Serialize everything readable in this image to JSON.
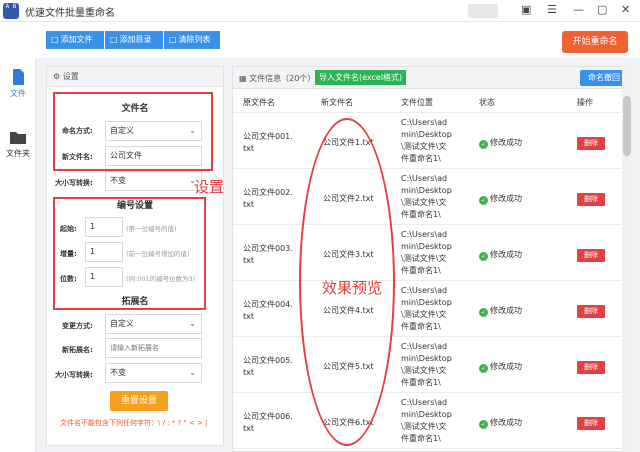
{
  "window": {
    "title": "优速文件批量重命名",
    "logo_text": "A B"
  },
  "toolbar": {
    "add_file": "添加文件",
    "add_dir": "添加目录",
    "clear_list": "清除列表",
    "start": "开始重命名"
  },
  "nav": {
    "file": "文件",
    "folder": "文件夹"
  },
  "settings": {
    "header": "设置",
    "filename_section": "文件名",
    "rename_mode_label": "命名方式:",
    "rename_mode_value": "自定义",
    "new_name_label": "新文件名:",
    "new_name_value": "公司文件",
    "case_label": "大小写转换:",
    "case_value": "不变",
    "numbering_section": "编号设置",
    "start_label": "起始:",
    "start_value": "1",
    "start_hint": "(第一位编号的值)",
    "increment_label": "增量:",
    "increment_value": "1",
    "increment_hint": "(前一位编号增加的值)",
    "digits_label": "位数:",
    "digits_value": "1",
    "digits_hint": "(例:001的编号位数为3)",
    "extension_section": "拓展名",
    "ext_mode_label": "变更方式:",
    "ext_mode_value": "自定义",
    "new_ext_label": "新拓展名:",
    "new_ext_placeholder": "请输入新拓展名",
    "ext_case_label": "大小写转换:",
    "ext_case_value": "不变",
    "reset": "重置设置",
    "warning": "文件名不能包含下列任何字符：\\ / : * ? \" < > |"
  },
  "annotations": {
    "settings": "设置",
    "preview": "效果预览"
  },
  "main": {
    "file_info": "文件信息（20个）",
    "import_button": "导入文件名(excel格式)",
    "undo_button": "命名撤回",
    "columns": [
      "原文件名",
      "新文件名",
      "文件位置",
      "状态",
      "操作"
    ],
    "rows": [
      {
        "orig": "公司文件001.\ntxt",
        "new": "公司文件1.txt",
        "loc": "C:\\Users\\ad\nmin\\Desktop\n\\测试文件\\文\n件重命名1\\",
        "status": "修改成功",
        "action": "删除"
      },
      {
        "orig": "公司文件002.\ntxt",
        "new": "公司文件2.txt",
        "loc": "C:\\Users\\ad\nmin\\Desktop\n\\测试文件\\文\n件重命名1\\",
        "status": "修改成功",
        "action": "删除"
      },
      {
        "orig": "公司文件003.\ntxt",
        "new": "公司文件3.txt",
        "loc": "C:\\Users\\ad\nmin\\Desktop\n\\测试文件\\文\n件重命名1\\",
        "status": "修改成功",
        "action": "删除"
      },
      {
        "orig": "公司文件004.\ntxt",
        "new": "公司文件4.txt",
        "loc": "C:\\Users\\ad\nmin\\Desktop\n\\测试文件\\文\n件重命名1\\",
        "status": "修改成功",
        "action": "删除"
      },
      {
        "orig": "公司文件005.\ntxt",
        "new": "公司文件5.txt",
        "loc": "C:\\Users\\ad\nmin\\Desktop\n\\测试文件\\文\n件重命名1\\",
        "status": "修改成功",
        "action": "删除"
      },
      {
        "orig": "公司文件006.\ntxt",
        "new": "公司文件6.txt",
        "loc": "C:\\Users\\ad\nmin\\Desktop\n\\测试文件\\文\n件重命名1\\",
        "status": "修改成功",
        "action": "删除"
      }
    ]
  }
}
